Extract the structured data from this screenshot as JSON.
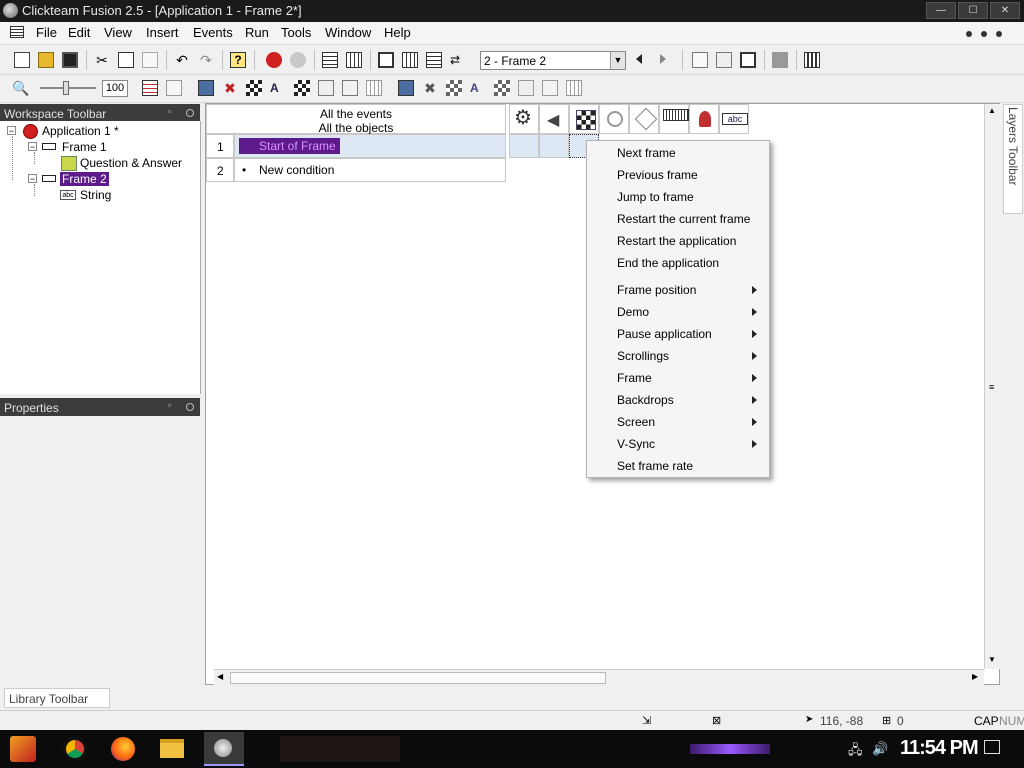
{
  "window": {
    "title": "Clickteam Fusion 2.5 - [Application 1 - Frame 2*]"
  },
  "menu": [
    "File",
    "Edit",
    "View",
    "Insert",
    "Events",
    "Run",
    "Tools",
    "Window",
    "Help"
  ],
  "toolbar": {
    "frame_select": "2 - Frame 2",
    "zoom_value": "100"
  },
  "workspace": {
    "title": "Workspace Toolbar",
    "tree": {
      "app": "Application 1 *",
      "frame1": "Frame 1",
      "frame1_obj": "Question & Answer",
      "frame2": "Frame 2",
      "frame2_obj": "String"
    }
  },
  "properties": {
    "title": "Properties"
  },
  "library": {
    "title": "Library Toolbar"
  },
  "layers": {
    "title": "Layers Toolbar"
  },
  "events": {
    "header_line1": "All the events",
    "header_line2": "All the objects",
    "rows": [
      {
        "num": "1",
        "text": "Start of Frame"
      },
      {
        "num": "2",
        "text": "New condition"
      }
    ]
  },
  "context_menu": {
    "items": [
      {
        "label": "Next frame"
      },
      {
        "label": "Previous frame"
      },
      {
        "label": "Jump to frame"
      },
      {
        "label": "Restart the current frame"
      },
      {
        "label": "Restart the application"
      },
      {
        "label": "End the application"
      },
      {
        "label": "Frame position"
      },
      {
        "label": "Demo"
      },
      {
        "label": "Pause application"
      },
      {
        "label": "Scrollings"
      },
      {
        "label": "Frame"
      },
      {
        "label": "Backdrops"
      },
      {
        "label": "Screen"
      },
      {
        "label": "V-Sync"
      },
      {
        "label": "Set frame rate"
      }
    ]
  },
  "statusbar": {
    "coords": "116, -88",
    "count": "0",
    "cap": "CAP",
    "num": "NUM"
  },
  "taskbar": {
    "clock": "11:54 PM"
  },
  "colors": {
    "selection": "#5c1a8a",
    "accent_purple": "#7a3cc8",
    "title_bg": "#1a1a1a"
  }
}
